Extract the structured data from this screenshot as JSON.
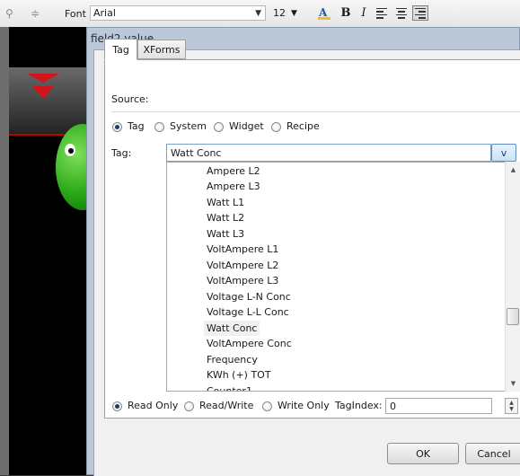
{
  "toolbar": {
    "font_label": "Font",
    "font_value": "Arial",
    "size_value": "12",
    "bold_label": "B",
    "italic_label": "I"
  },
  "dialog": {
    "title": "field2.value",
    "tabs": [
      {
        "label": "Tag",
        "active": true
      },
      {
        "label": "XForms",
        "active": false
      }
    ],
    "source_label": "Source:",
    "source_options": [
      {
        "label": "Tag",
        "selected": true
      },
      {
        "label": "System",
        "selected": false
      },
      {
        "label": "Widget",
        "selected": false
      },
      {
        "label": "Recipe",
        "selected": false
      }
    ],
    "tag_label": "Tag:",
    "tag_value": "Watt Conc",
    "dropdown_button": "v",
    "tag_list": [
      "Ampere L2",
      "Ampere L3",
      "Watt L1",
      "Watt L2",
      "Watt L3",
      "VoltAmpere L1",
      "VoltAmpere L2",
      "VoltAmpere L3",
      "Voltage L-N Conc",
      "Voltage L-L Conc",
      "Watt Conc",
      "VoltAmpere Conc",
      "Frequency",
      "KWh (+) TOT",
      "Counter1"
    ],
    "selected_tag": "Watt Conc",
    "access_options": [
      {
        "label": "Read Only",
        "selected": true
      },
      {
        "label": "Read/Write",
        "selected": false
      },
      {
        "label": "Write Only",
        "selected": false
      }
    ],
    "tagindex_label": "TagIndex:",
    "tagindex_value": "0",
    "ok_label": "OK",
    "cancel_label": "Cancel"
  },
  "colors": {
    "dialog_frame": "#bcc8d8",
    "accent_red": "#d2141c",
    "smiley_green": "#2aa817"
  }
}
